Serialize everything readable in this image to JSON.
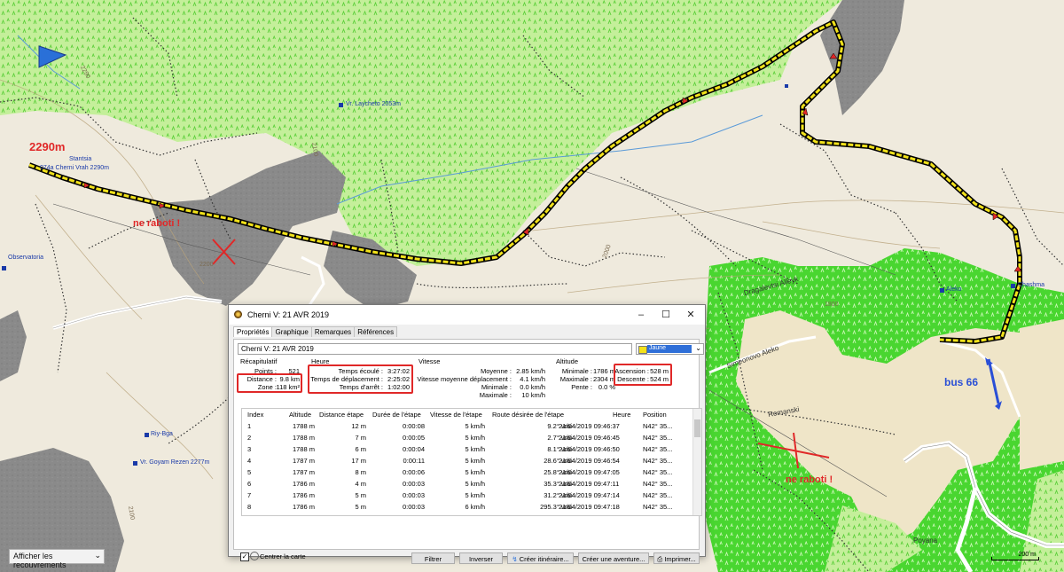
{
  "map": {
    "labels": {
      "alt_2290": "2290m",
      "ne_raboti": "ne raboti !",
      "ne_raboti_2": "ne raboti !",
      "bus": "bus 66",
      "contour_2290": "2290",
      "contour_2100": "2100",
      "contour_2200": "2200",
      "contour_2000": "2000",
      "contour_1800": "1800",
      "contour_2100b": "2100",
      "poi_stantsia": "Stantsia",
      "poi_cherni": "074a Cherni Vrah 2290m",
      "poi_observatoria": "Observatoria",
      "poi_laycheto": "Vr. Laycheto 2053m",
      "poi_goyam": "Vr. Goyam Rezen 2277m",
      "poi_riy": "Riy-Bga",
      "poi_aleko": "Aleko",
      "poi_chashma": "Chashma",
      "poi_romansk": "Romanski",
      "road_dragalevtsi": "Dragalevtsi Alleyk",
      "road_simeonovo": "Simeonovo Aleko",
      "road_poyana": "Poyana"
    },
    "overlay_select": "Afficher les recouvrements",
    "scale": "200 m",
    "colors": {
      "forest": "#c4ef9a",
      "meadow": "#49d630",
      "rock": "#8a8a8a",
      "track": "#f2e21a",
      "annotation": "#e02828",
      "bus_arrow": "#2a4fd6"
    }
  },
  "dialog": {
    "title": "Cherni V: 21 AVR 2019",
    "tabs": [
      "Propriétés",
      "Graphique",
      "Remarques",
      "Références"
    ],
    "name_value": "Cherni V: 21 AVR 2019",
    "color_value": "Jaune",
    "recap": {
      "title": "Récapitulatif",
      "points_label": "Points :",
      "points_value": "521",
      "distance_label": "Distance :",
      "distance_value": "9.8 km",
      "zone_label": "Zone :",
      "zone_value": "118 km²"
    },
    "heure": {
      "title": "Heure",
      "ecoule_label": "Temps écoulé :",
      "ecoule_value": "3:27:02",
      "deplacement_label": "Temps de déplacement :",
      "deplacement_value": "2:25:02",
      "arret_label": "Temps d'arrêt :",
      "arret_value": "1:02:00"
    },
    "vitesse": {
      "title": "Vitesse",
      "moyenne_label": "Moyenne :",
      "moyenne_value": "2.85 km/h",
      "deplacement_label": "Vitesse moyenne déplacement :",
      "deplacement_value": "4.1 km/h",
      "min_label": "Minimale :",
      "min_value": "0.0 km/h",
      "max_label": "Maximale :",
      "max_value": "10 km/h"
    },
    "altitude": {
      "title": "Altitude",
      "min_label": "Minimale :",
      "min_value": "1786 m",
      "max_label": "Maximale :",
      "max_value": "2304 m",
      "pente_label": "Pente :",
      "pente_value": "0.0 %",
      "asc_label": "Ascension :",
      "asc_value": "528 m",
      "desc_label": "Descente :",
      "desc_value": "524 m"
    },
    "table": {
      "headers": [
        "Index",
        "Altitude",
        "Distance étape",
        "Durée de l'étape",
        "Vitesse de l'étape",
        "Route désirée de l'étape",
        "Heure",
        "Position"
      ],
      "rows": [
        [
          "1",
          "1788 m",
          "12 m",
          "0:00:08",
          "5 km/h",
          "9.2° vrai",
          "21/04/2019 09:46:37",
          "N42° 35..."
        ],
        [
          "2",
          "1788 m",
          "7 m",
          "0:00:05",
          "5 km/h",
          "2.7° vrai",
          "21/04/2019 09:46:45",
          "N42° 35..."
        ],
        [
          "3",
          "1788 m",
          "6 m",
          "0:00:04",
          "5 km/h",
          "8.1° vrai",
          "21/04/2019 09:46:50",
          "N42° 35..."
        ],
        [
          "4",
          "1787 m",
          "17 m",
          "0:00:11",
          "5 km/h",
          "28.6° vrai",
          "21/04/2019 09:46:54",
          "N42° 35..."
        ],
        [
          "5",
          "1787 m",
          "8 m",
          "0:00:06",
          "5 km/h",
          "25.8° vrai",
          "21/04/2019 09:47:05",
          "N42° 35..."
        ],
        [
          "6",
          "1786 m",
          "4 m",
          "0:00:03",
          "5 km/h",
          "35.3° vrai",
          "21/04/2019 09:47:11",
          "N42° 35..."
        ],
        [
          "7",
          "1786 m",
          "5 m",
          "0:00:03",
          "5 km/h",
          "31.2° vrai",
          "21/04/2019 09:47:14",
          "N42° 35..."
        ],
        [
          "8",
          "1786 m",
          "5 m",
          "0:00:03",
          "6 km/h",
          "295.3° vrai",
          "21/04/2019 09:47:18",
          "N42° 35..."
        ]
      ]
    },
    "center_map_label": "Centrer la carte",
    "buttons": {
      "filter": "Filtrer",
      "invert": "Inverser",
      "create_route": "Créer itinéraire...",
      "create_adventure": "Créer une aventure...",
      "print": "Imprimer..."
    }
  }
}
